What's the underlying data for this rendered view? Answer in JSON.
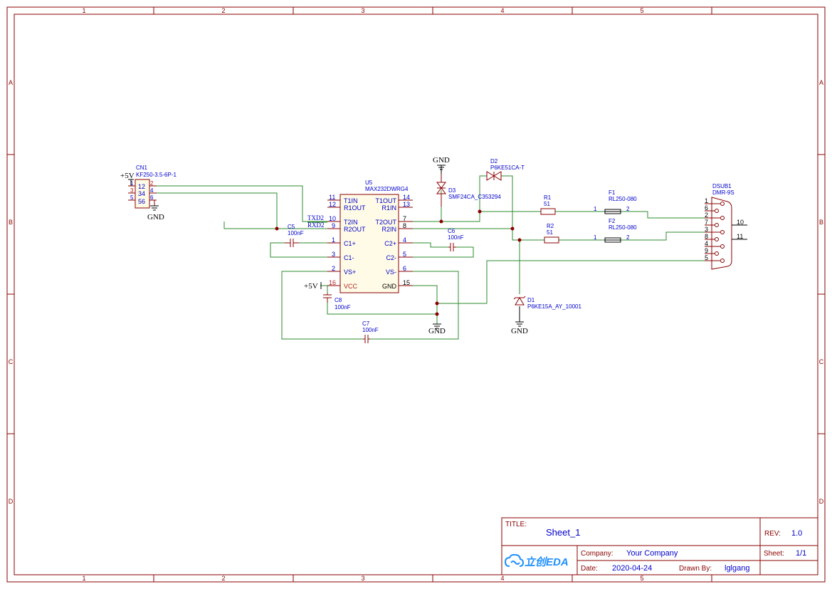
{
  "frame": {
    "col_labels": [
      "1",
      "2",
      "3",
      "4",
      "5"
    ],
    "row_labels": [
      "A",
      "B",
      "C",
      "D"
    ]
  },
  "components": {
    "cn1": {
      "ref": "CN1",
      "value": "KF250-3.5-6P-1",
      "pins": [
        "1",
        "2",
        "3",
        "4",
        "5",
        "6"
      ],
      "inner": [
        "12",
        "34",
        "56"
      ]
    },
    "u5": {
      "ref": "U5",
      "value": "MAX232DWRG4",
      "left_pins": [
        {
          "num": "11",
          "name": "T1IN"
        },
        {
          "num": "12",
          "name": "R1OUT"
        },
        {
          "num": "10",
          "name": "T2IN"
        },
        {
          "num": "9",
          "name": "R2OUT"
        },
        {
          "num": "1",
          "name": "C1+"
        },
        {
          "num": "3",
          "name": "C1-"
        },
        {
          "num": "2",
          "name": "VS+"
        },
        {
          "num": "16",
          "name": "VCC"
        }
      ],
      "right_pins": [
        {
          "num": "14",
          "name": "T1OUT"
        },
        {
          "num": "13",
          "name": "R1IN"
        },
        {
          "num": "7",
          "name": "T2OUT"
        },
        {
          "num": "8",
          "name": "R2IN"
        },
        {
          "num": "4",
          "name": "C2+"
        },
        {
          "num": "5",
          "name": "C2-"
        },
        {
          "num": "6",
          "name": "VS-"
        },
        {
          "num": "15",
          "name": "GND"
        }
      ]
    },
    "c5": {
      "ref": "C5",
      "value": "100nF"
    },
    "c6": {
      "ref": "C6",
      "value": "100nF"
    },
    "c7": {
      "ref": "C7",
      "value": "100nF"
    },
    "c8": {
      "ref": "C8",
      "value": "100nF"
    },
    "d1": {
      "ref": "D1",
      "value": "P6KE15A_AY_10001"
    },
    "d2": {
      "ref": "D2",
      "value": "P6KE51CA-T"
    },
    "d3": {
      "ref": "D3",
      "value": "SMF24CA_C353294"
    },
    "r1": {
      "ref": "R1",
      "value": "51"
    },
    "r2": {
      "ref": "R2",
      "value": "51"
    },
    "f1": {
      "ref": "F1",
      "value": "RL250-080",
      "pin1": "1",
      "pin2": "2"
    },
    "f2": {
      "ref": "F2",
      "value": "RL250-080",
      "pin1": "1",
      "pin2": "2"
    },
    "dsub1": {
      "ref": "DSUB1",
      "value": "DMR-9S",
      "pins": [
        "1",
        "6",
        "2",
        "7",
        "3",
        "8",
        "4",
        "9",
        "5"
      ],
      "shield": [
        "10",
        "11"
      ]
    }
  },
  "nets": {
    "txd": "TXD2",
    "rxd": "RXD2",
    "vcc": "+5V",
    "gnd": "GND"
  },
  "title_block": {
    "title_label": "TITLE:",
    "title": "Sheet_1",
    "rev_label": "REV:",
    "rev": "1.0",
    "company_label": "Company:",
    "company": "Your Company",
    "sheet_label": "Sheet:",
    "sheet": "1/1",
    "date_label": "Date:",
    "date": "2020-04-24",
    "drawn_label": "Drawn By:",
    "drawn": "lglgang",
    "logo_text": "立创EDA"
  }
}
